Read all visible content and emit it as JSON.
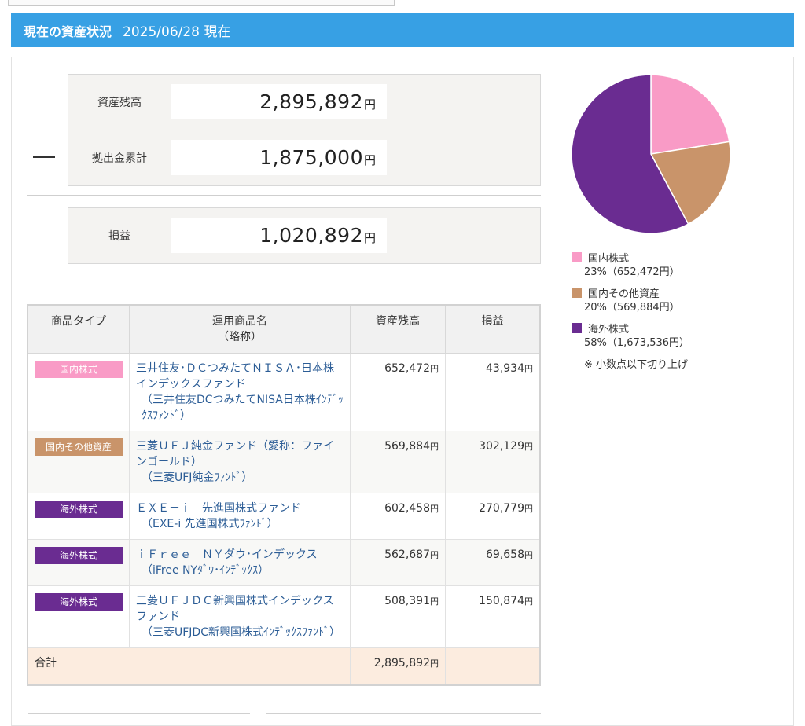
{
  "header": {
    "title": "現在の資産状況",
    "date": "2025/06/28 現在"
  },
  "summary": {
    "balance_label": "資産残高",
    "balance_value": "2,895,892",
    "contrib_label": "拠出金累計",
    "contrib_value": "1,875,000",
    "profit_label": "損益",
    "profit_value": "1,020,892",
    "yen": "円"
  },
  "table": {
    "headers": {
      "type": "商品タイプ",
      "name": "運用商品名",
      "name_sub": "（略称）",
      "balance": "資産残高",
      "profit": "損益"
    },
    "rows": [
      {
        "type": "国内株式",
        "type_color": "#f99bc6",
        "name": "三井住友･ＤＣつみたてＮＩＳＡ･日本株インデックスファンド",
        "short": "（三井住友DCつみたてNISA日本株ｲﾝﾃﾞｯｸｽﾌｧﾝﾄﾞ）",
        "balance": "652,472",
        "profit": "43,934"
      },
      {
        "type": "国内その他資産",
        "type_color": "#c9946a",
        "name": "三菱ＵＦＪ純金ファンド（愛称：ファインゴールド）",
        "short": "（三菱UFJ純金ﾌｧﾝﾄﾞ）",
        "balance": "569,884",
        "profit": "302,129"
      },
      {
        "type": "海外株式",
        "type_color": "#6a2c91",
        "name": "ＥＸＥ－ｉ　先進国株式ファンド",
        "short": "（EXE-i 先進国株式ﾌｧﾝﾄﾞ）",
        "balance": "602,458",
        "profit": "270,779"
      },
      {
        "type": "海外株式",
        "type_color": "#6a2c91",
        "name": "ｉＦｒｅｅ　ＮＹダウ･インデックス",
        "short": "（iFree NYﾀﾞｳ･ｲﾝﾃﾞｯｸｽ）",
        "balance": "562,687",
        "profit": "69,658"
      },
      {
        "type": "海外株式",
        "type_color": "#6a2c91",
        "name": "三菱ＵＦＪＤＣ新興国株式インデックスファンド",
        "short": "（三菱UFJDC新興国株式ｲﾝﾃﾞｯｸｽﾌｧﾝﾄﾞ）",
        "balance": "508,391",
        "profit": "150,874"
      }
    ],
    "total_label": "合計",
    "total_balance": "2,895,892"
  },
  "chart_data": {
    "type": "pie",
    "slices": [
      {
        "name": "国内株式",
        "percent": 23,
        "value": 652472,
        "label": "23%（652,472円）",
        "color": "#f99bc6"
      },
      {
        "name": "国内その他資産",
        "percent": 20,
        "value": 569884,
        "label": "20%（569,884円）",
        "color": "#c9946a"
      },
      {
        "name": "海外株式",
        "percent": 58,
        "value": 1673536,
        "label": "58%（1,673,536円）",
        "color": "#6a2c91"
      }
    ],
    "legend_position": "bottom",
    "note": "※ 小数点以下切り上げ"
  }
}
